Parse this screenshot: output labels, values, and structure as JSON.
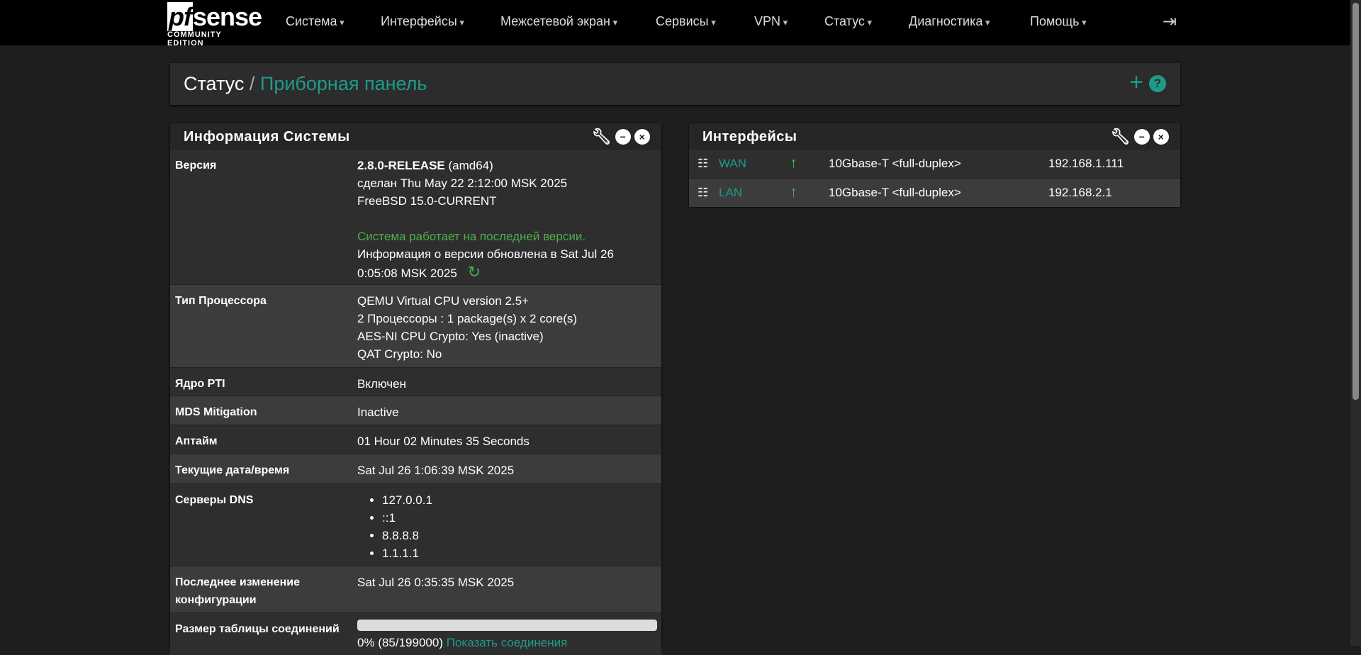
{
  "nav": {
    "logo_main": "sense",
    "logo_pf": "pf",
    "logo_sub": "COMMUNITY EDITION",
    "menu": [
      "Система",
      "Интерфейсы",
      "Межсетевой экран",
      "Сервисы",
      "VPN",
      "Статус",
      "Диагностика",
      "Помощь"
    ]
  },
  "breadcrumb": {
    "section": "Статус",
    "sep": "/",
    "page": "Приборная панель"
  },
  "sysinfo": {
    "title": "Информация Системы",
    "rows": {
      "version": {
        "label": "Версия",
        "release": "2.8.0-RELEASE",
        "arch": " (amd64)",
        "built": "сделан Thu May 22 2:12:00 MSK 2025",
        "os": "FreeBSD 15.0-CURRENT",
        "status": "Система работает на последней версии.",
        "updated1": "Информация о версии обновлена в Sat Jul 26",
        "updated2": "0:05:08 MSK 2025"
      },
      "cpu": {
        "label": "Тип Процессора",
        "lines": [
          "QEMU Virtual CPU version 2.5+",
          "2 Процессоры : 1 package(s) x 2 core(s)",
          "AES-NI CPU Crypto: Yes (inactive)",
          "QAT Crypto: No"
        ]
      },
      "pti": {
        "label": "Ядро PTI",
        "value": "Включен"
      },
      "mds": {
        "label": "MDS Mitigation",
        "value": "Inactive"
      },
      "uptime": {
        "label": "Аптайм",
        "value": "01 Hour 02 Minutes 35 Seconds"
      },
      "datetime": {
        "label": "Текущие дата/время",
        "value": "Sat Jul 26 1:06:39 MSK 2025"
      },
      "dns": {
        "label": "Серверы DNS",
        "servers": [
          "127.0.0.1",
          "::1",
          "8.8.8.8",
          "1.1.1.1"
        ]
      },
      "lastchange": {
        "label": "Последнее изменение конфигурации",
        "value": "Sat Jul 26 0:35:35 MSK 2025"
      },
      "states": {
        "label": "Размер таблицы соединений",
        "value": "0% (85/199000)",
        "link": "Показать соединения",
        "percent": 0.04
      }
    }
  },
  "interfaces": {
    "title": "Интерфейсы",
    "rows": [
      {
        "name": "WAN",
        "status": "up",
        "media": "10Gbase-T <full-duplex>",
        "ip": "192.168.1.111"
      },
      {
        "name": "LAN",
        "status": "up",
        "media": "10Gbase-T <full-duplex>",
        "ip": "192.168.2.1"
      }
    ]
  }
}
